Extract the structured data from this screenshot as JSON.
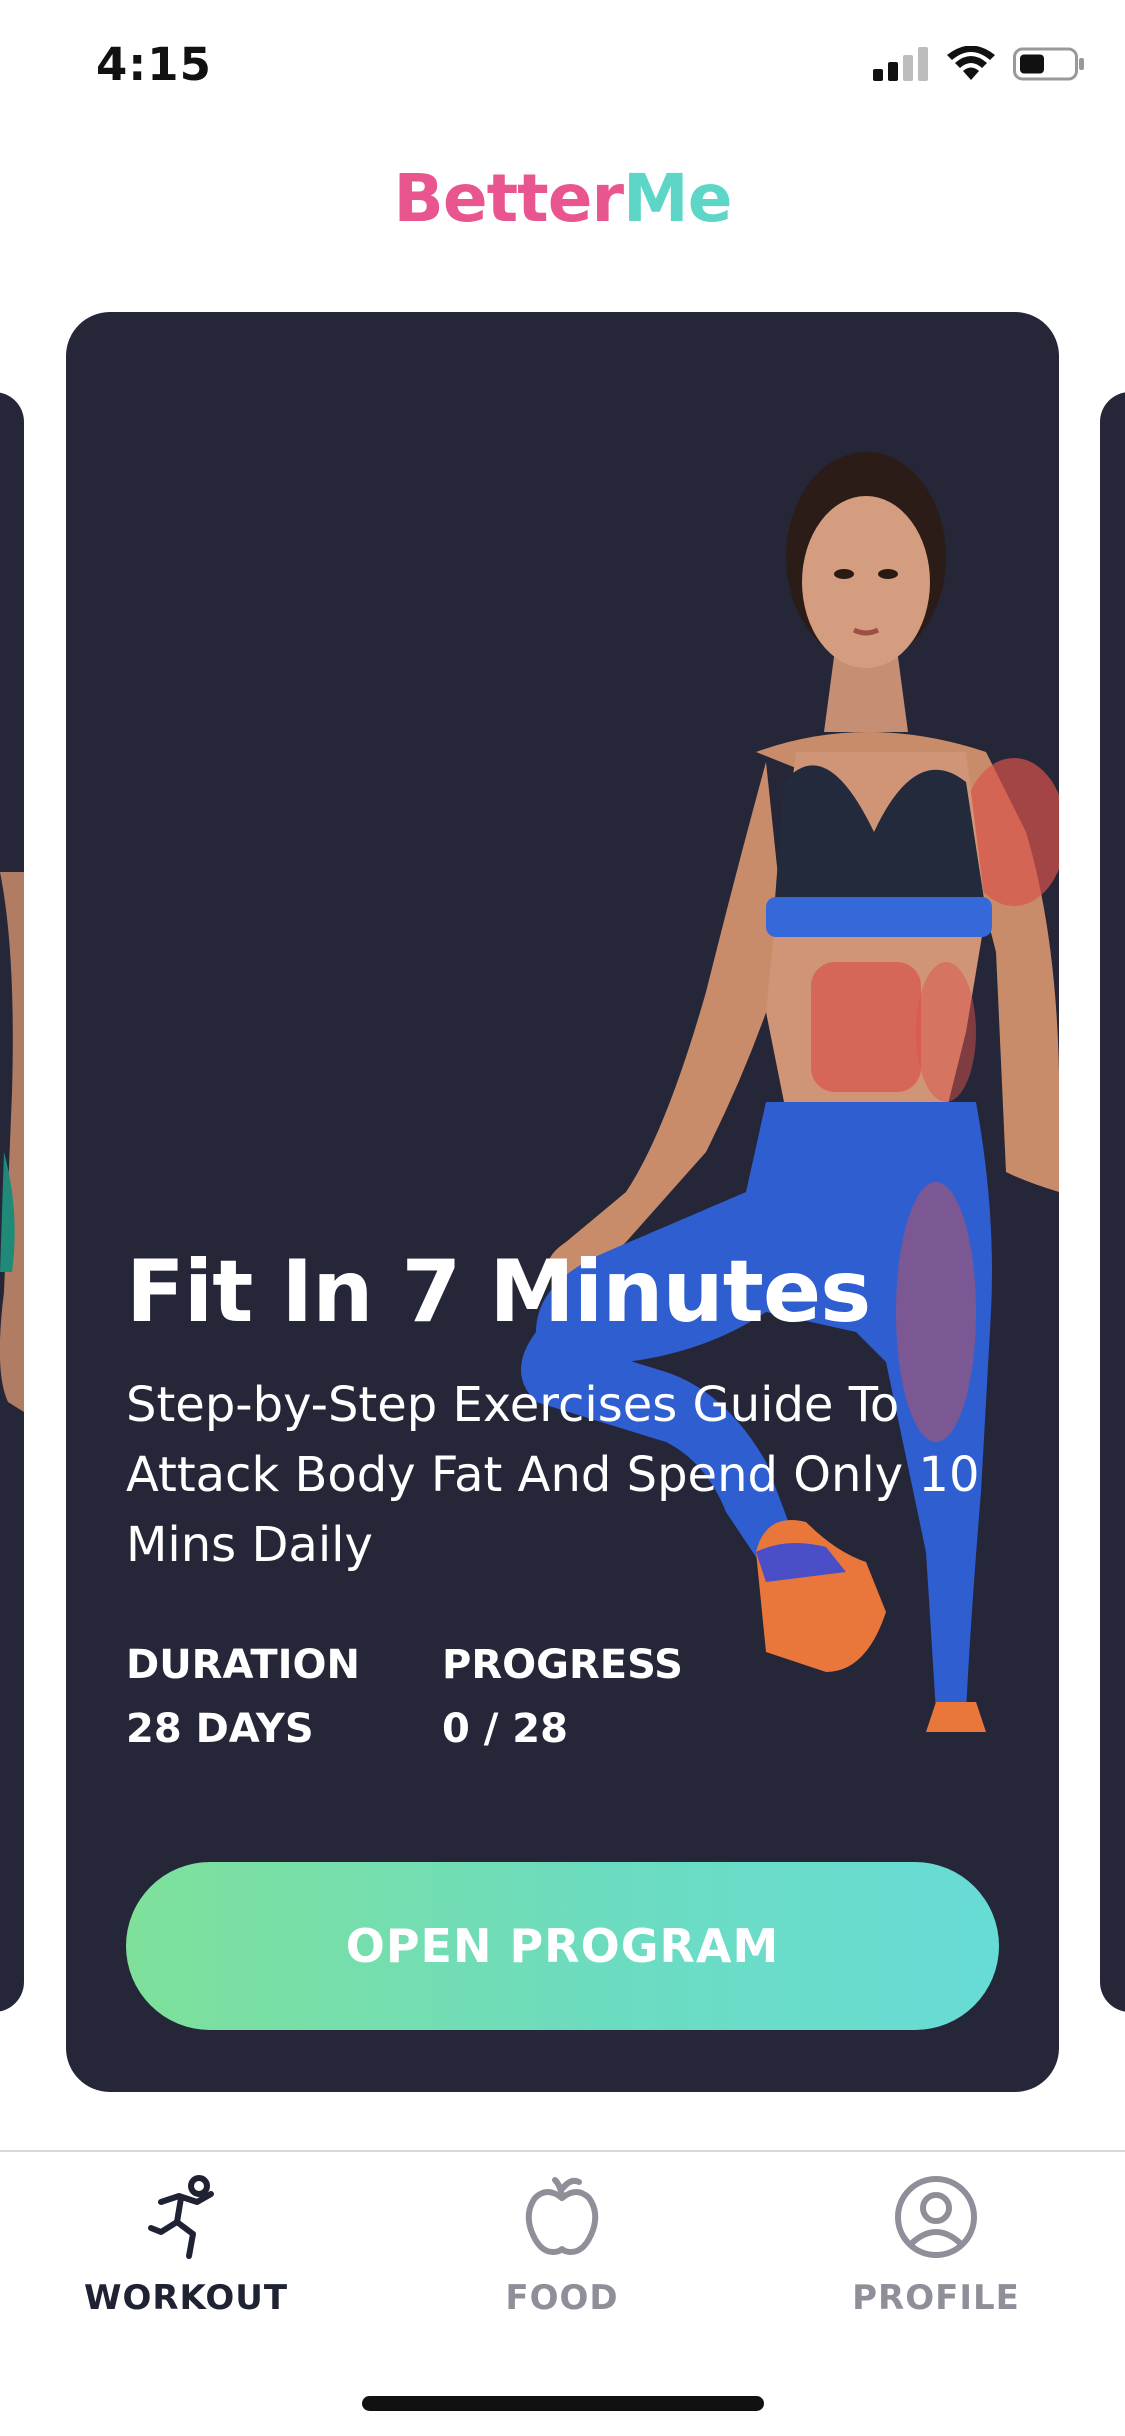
{
  "status_bar": {
    "time": "4:15",
    "icons": [
      "signal-icon",
      "wifi-icon",
      "battery-icon"
    ]
  },
  "logo": {
    "part1": "Better",
    "part2": "Me"
  },
  "program_card": {
    "title": "Fit In 7 Minutes",
    "description": "Step-by-Step Exercises Guide To Attack Body Fat And Spend Only 10 Mins Daily",
    "duration_label": "DURATION",
    "duration_value": "28 DAYS",
    "progress_label": "PROGRESS",
    "progress_value": "0 / 28",
    "button_label": "OPEN PROGRAM"
  },
  "tab_bar": {
    "items": [
      {
        "label": "WORKOUT",
        "icon": "running-person-icon",
        "active": true
      },
      {
        "label": "FOOD",
        "icon": "apple-icon",
        "active": false
      },
      {
        "label": "PROFILE",
        "icon": "profile-icon",
        "active": false
      }
    ]
  },
  "colors": {
    "card_background": "#252638",
    "logo_pink": "#e9558f",
    "logo_teal": "#5dd6c8",
    "button_gradient_start": "#7ee09a",
    "button_gradient_end": "#67dcd6"
  }
}
